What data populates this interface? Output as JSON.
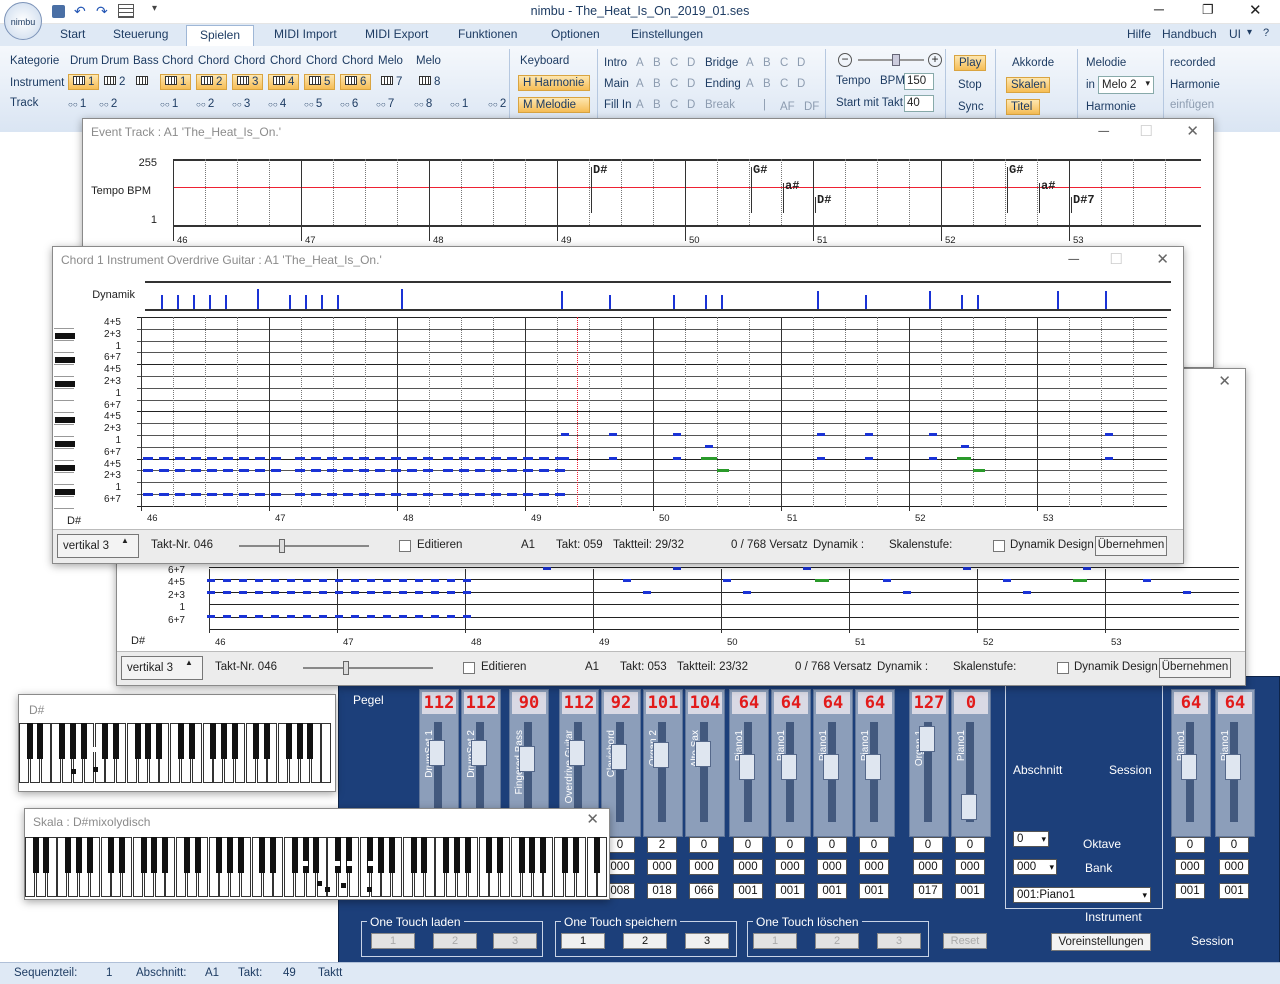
{
  "app": {
    "title": "nimbu - The_Heat_Is_On_2019_01.ses",
    "logo": "nimbu"
  },
  "qat": {
    "icons": [
      "save-icon",
      "undo-icon",
      "redo-icon",
      "grid-icon",
      "dropdown-icon"
    ]
  },
  "tabs": [
    "Start",
    "Steuerung",
    "Spielen",
    "MIDI Import",
    "MIDI Export",
    "Funktionen",
    "Optionen",
    "Einstellungen"
  ],
  "active_tab": "Spielen",
  "right_menu": {
    "hilfe": "Hilfe",
    "handbuch": "Handbuch",
    "ui": "UI"
  },
  "ribbon": {
    "kategorie": "Kategorie",
    "instrument": "Instrument",
    "track": "Track",
    "cats": [
      "Drum",
      "Drum",
      "Bass",
      "Chord",
      "Chord",
      "Chord",
      "Chord",
      "Chord",
      "Chord",
      "Melo",
      "Melo"
    ],
    "inst_nums": [
      "1",
      "2",
      "",
      "1",
      "2",
      "3",
      "4",
      "5",
      "6",
      "7",
      "8"
    ],
    "track_nums": [
      "1",
      "2",
      "",
      "1",
      "2",
      "3",
      "4",
      "5",
      "6",
      "7",
      "8",
      "1",
      "2"
    ],
    "keyboard": "Keyboard",
    "harmonie_btn": "H  Harmonie",
    "melodie_btn": "M  Melodie",
    "intro": "Intro",
    "main": "Main",
    "fillin": "Fill In",
    "bridge": "Bridge",
    "ending": "Ending",
    "break": "Break",
    "abcd": [
      "A",
      "B",
      "C",
      "D"
    ],
    "af": "AF",
    "df": "DF",
    "tempo": "Tempo",
    "bpm_label": "BPM",
    "bpm": "150",
    "start_takt_label": "Start mit Takt",
    "start_takt": "40",
    "play": "Play",
    "stop": "Stop",
    "sync": "Sync",
    "akkorde": "Akkorde",
    "skalen": "Skalen",
    "titel": "Titel",
    "melodie": "Melodie",
    "in": "in",
    "melo_select": "Melo 2",
    "harmonie": "Harmonie",
    "recorded": "recorded",
    "harmonie2": "Harmonie",
    "einfuegen": "einfügen"
  },
  "event_track": {
    "title": "Event Track   :   A1  'The_Heat_Is_On.'",
    "tempo_label": "Tempo  BPM",
    "y_max": "255",
    "y_min": "1",
    "chords": [
      "D#",
      "G#",
      "a#",
      "D#",
      "G#",
      "a#",
      "D#7"
    ],
    "measures": [
      "46",
      "47",
      "48",
      "49",
      "50",
      "51",
      "52",
      "53"
    ]
  },
  "chord_window": {
    "title": "Chord 1 Instrument  Overdrive Guitar   :   A1  'The_Heat_Is_On.'",
    "dynamik": "Dynamik",
    "rows": [
      "4+5",
      "2+3",
      "1",
      "6+7",
      "4+5",
      "2+3",
      "1",
      "6+7",
      "4+5",
      "2+3",
      "1",
      "6+7",
      "4+5",
      "2+3",
      "1",
      "6+7"
    ],
    "bottom_note": "D#",
    "measures": [
      "46",
      "47",
      "48",
      "49",
      "50",
      "51",
      "52",
      "53"
    ],
    "vertikal": "vertikal 3",
    "takt_nr": "Takt-Nr.  046",
    "editieren": "Editieren",
    "section": "A1",
    "takt": "Takt:  059",
    "taktteil": "Taktteil:  29/32",
    "versatz": "0   / 768 Versatz",
    "dynamik2": "Dynamik :",
    "skalenstufe": "Skalenstufe:",
    "dynamik_design": "Dynamik Design",
    "uebernehmen": "Übernehmen"
  },
  "chord_window2": {
    "rows": [
      "6+7",
      "4+5",
      "2+3",
      "1",
      "6+7"
    ],
    "bottom_note": "D#",
    "measures": [
      "46",
      "47",
      "48",
      "49",
      "50",
      "51",
      "52",
      "53"
    ],
    "vertikal": "vertikal 3",
    "takt_nr": "Takt-Nr.  046",
    "editieren": "Editieren",
    "section": "A1",
    "takt": "Takt:  053",
    "taktteil": "Taktteil:  23/32",
    "versatz": "0   / 768 Versatz",
    "dynamik2": "Dynamik :",
    "skalenstufe": "Skalenstufe:",
    "dynamik_design": "Dynamik Design",
    "uebernehmen": "Übernehmen"
  },
  "kb1": {
    "title": "D#"
  },
  "kb2": {
    "title": "Skala : D#mixolydisch"
  },
  "mixer": {
    "pegel": "Pegel",
    "channels": [
      {
        "level": "112",
        "name": "DrumSet 1",
        "fader": 0.78
      },
      {
        "level": "112",
        "name": "DrumSet 2",
        "fader": 0.78
      },
      {
        "level": "90",
        "name": "Fingered Bass",
        "fader": 0.7
      },
      {
        "level": "112",
        "name": "Overdrive Guitar",
        "fader": 0.78
      },
      {
        "level": "92",
        "name": "Clavichord",
        "fader": 0.72
      },
      {
        "level": "101",
        "name": "Organ 2",
        "fader": 0.75
      },
      {
        "level": "104",
        "name": "Alto Sax",
        "fader": 0.76
      },
      {
        "level": "64",
        "name": "Piano1",
        "fader": 0.6
      },
      {
        "level": "64",
        "name": "Piano1",
        "fader": 0.6
      },
      {
        "level": "64",
        "name": "Piano1",
        "fader": 0.6
      },
      {
        "level": "64",
        "name": "Piano1",
        "fader": 0.6
      },
      {
        "level": "127",
        "name": "Organ 1",
        "fader": 0.95
      },
      {
        "level": "0",
        "name": "Piano1",
        "fader": 0.1
      },
      {
        "level": "64",
        "name": "Piano1",
        "fader": 0.6
      },
      {
        "level": "64",
        "name": "Piano1",
        "fader": 0.6
      }
    ],
    "row1": [
      "0",
      "2",
      "0",
      "0",
      "0",
      "0",
      "0",
      "0",
      "0"
    ],
    "row2": [
      "000",
      "000",
      "000",
      "000",
      "000",
      "000",
      "000",
      "000",
      "000"
    ],
    "row3": [
      "008",
      "018",
      "066",
      "001",
      "001",
      "001",
      "001",
      "017",
      "001",
      "001",
      "001"
    ],
    "row1r": [
      "0",
      "0"
    ],
    "row2r": [
      "000",
      "000"
    ],
    "abschnitt": "Abschnitt",
    "session": "Session",
    "oktave": "Oktave",
    "bank": "Bank",
    "oktave_val": "0",
    "bank_val": "000",
    "instrument_val": "001:Piano1",
    "instrument": "Instrument",
    "voreinstellungen": "Voreinstellungen",
    "session2": "Session",
    "ot_laden": "One Touch laden",
    "ot_speichern": "One Touch speichern",
    "ot_loeschen": "One Touch löschen",
    "reset": "Reset",
    "nums": [
      "1",
      "2",
      "3"
    ]
  },
  "status": {
    "sequenzteil": "Sequenzteil:",
    "seq_val": "1",
    "abschnitt": "Abschnitt:",
    "abs_val": "A1",
    "takt": "Takt:",
    "takt_val": "49",
    "taktteil": "Taktt"
  }
}
